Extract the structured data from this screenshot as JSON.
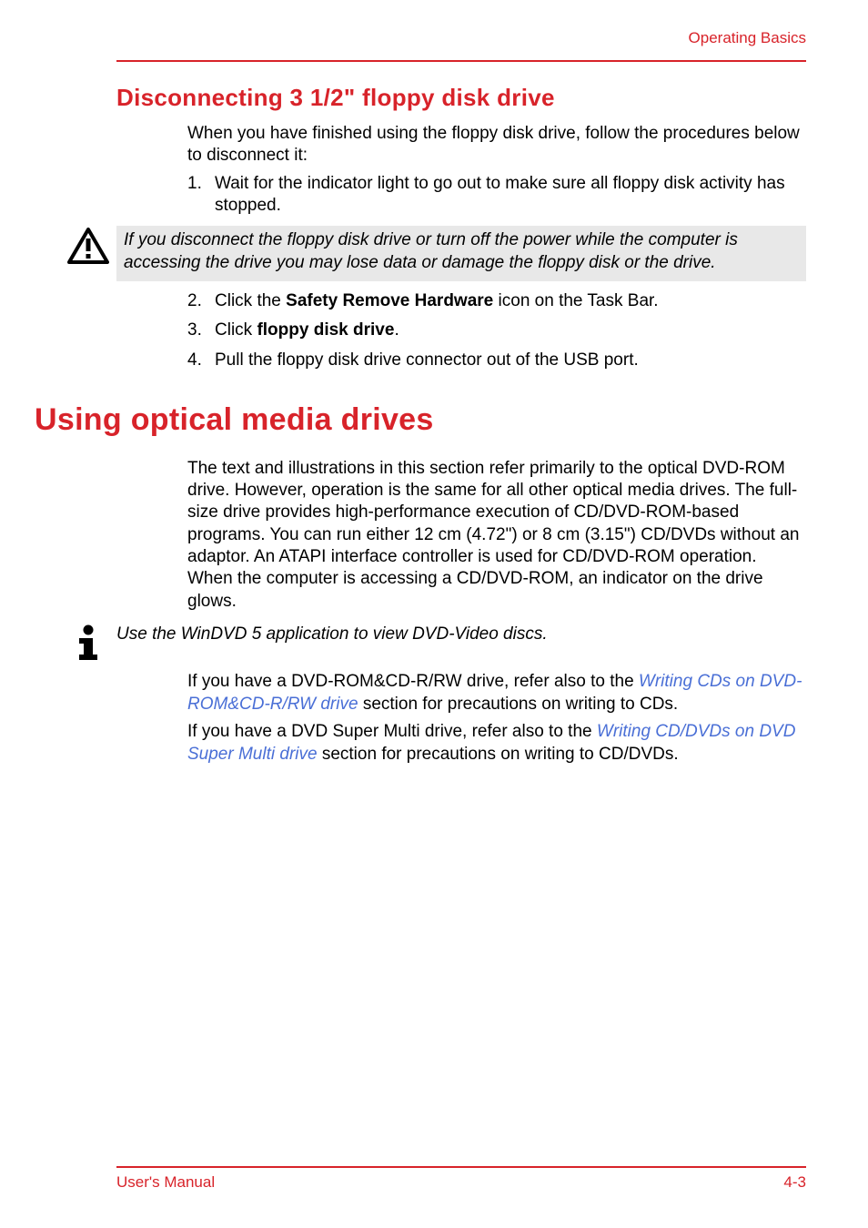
{
  "header": {
    "label": "Operating Basics"
  },
  "sections": {
    "disc": {
      "title": "Disconnecting 3 1/2\" floppy disk drive",
      "intro": "When you have finished using the floppy disk drive, follow the procedures below to disconnect it:",
      "steps": {
        "s1": {
          "num": "1.",
          "text": "Wait for the indicator light to go out to make sure all floppy disk activity has stopped."
        },
        "s2": {
          "num": "2.",
          "pre": "Click the ",
          "bold": "Safety Remove Hardware",
          "post": " icon on the Task Bar."
        },
        "s3": {
          "num": "3.",
          "pre": "Click ",
          "bold": "floppy disk drive",
          "post": "."
        },
        "s4": {
          "num": "4.",
          "text": "Pull the floppy disk drive connector out of the USB port."
        }
      },
      "warn": "If you disconnect the floppy disk drive or turn off the power while the computer is accessing the drive you may lose data or damage the floppy disk or the drive."
    },
    "optical": {
      "title": "Using optical media drives",
      "para": "The text and illustrations in this section refer primarily to the optical DVD-ROM drive. However, operation is the same for all other optical media drives. The full-size drive provides high-performance execution of CD/DVD-ROM-based programs. You can run either 12 cm (4.72\") or 8 cm (3.15\") CD/DVDs without an adaptor. An ATAPI interface controller is used for CD/DVD-ROM operation. When the computer is accessing a CD/DVD-ROM, an indicator on the drive glows.",
      "info": "Use the WinDVD 5 application to view DVD-Video discs.",
      "links": {
        "p1_pre": "If you have a DVD-ROM&CD-R/RW drive, refer also to the ",
        "p1_link": "Writing CDs on DVD-ROM&CD-R/RW drive",
        "p1_post": " section for precautions on writing to CDs.",
        "p2_pre": "If you have a DVD Super Multi drive, refer also to the ",
        "p2_link": "Writing CD/DVDs on DVD Super Multi drive",
        "p2_post": " section for precautions on writing to CD/DVDs."
      }
    }
  },
  "footer": {
    "left": "User's Manual",
    "right": "4-3"
  }
}
